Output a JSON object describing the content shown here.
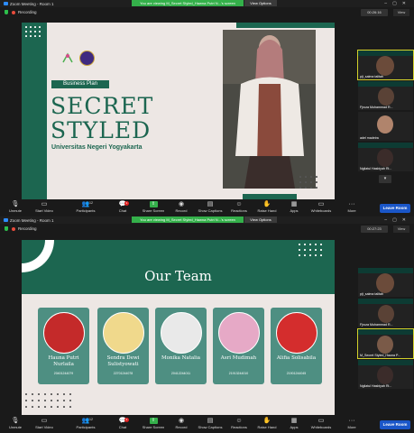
{
  "app": {
    "window_title": "Zoom Meeting - Room 1",
    "recording_label": "Recording",
    "view_options": "View Options",
    "leave_label": "Leave Room",
    "accent": "#2d8cff",
    "share_color": "#34b04a"
  },
  "top": {
    "banner": "You are viewing M_Secret Styled_Hawna Putri N...'s screen",
    "timer": "00:26:16",
    "grid_label": "View",
    "slide": {
      "subtitle": "Business Plan",
      "title_line1": "SECRET",
      "title_line2": "STYLED",
      "university": "Universitas Negeri Yogyakarta"
    },
    "participants": [
      {
        "name": "pjt_salma talitah",
        "highlight": true
      },
      {
        "name": "Fjroza Muhammad R...",
        "highlight": false
      },
      {
        "name": "adel madeira",
        "highlight": false
      },
      {
        "name": "Ngilatul Hasbiyah Ri...",
        "highlight": false
      }
    ]
  },
  "bottom": {
    "banner": "You are viewing M_Secret Styled_Hawna Putri N...'s screen",
    "timer": "00:27:23",
    "grid_label": "View",
    "slide": {
      "title": "Our Team",
      "members": [
        {
          "name": "Hauna Putri Nurlaila",
          "id": "20401244079"
        },
        {
          "name": "Sendra Dewi Sulistyowati",
          "id": "22701244078"
        },
        {
          "name": "Monika Natalia",
          "id": "20412244011"
        },
        {
          "name": "Asri Mudimah",
          "id": "21913244010"
        },
        {
          "name": "Alifia Solisabila",
          "id": "21901244045"
        }
      ]
    },
    "participants": [
      {
        "name": "pjt_salma talitah",
        "highlight": false
      },
      {
        "name": "Fjroza Muhammad R...",
        "highlight": false
      },
      {
        "name": "M_Secret Styled_Hauna P...",
        "highlight": true
      },
      {
        "name": "Ngilatul Hasbiyah Ri...",
        "highlight": false
      }
    ]
  },
  "toolbar": {
    "unmute": "Unmute",
    "start_video": "Start Video",
    "participants": "Participants",
    "participants_count": "12",
    "chat": "Chat",
    "chat_badge": "1",
    "share_screen": "Share Screen",
    "record": "Record",
    "show_captions": "Show Captions",
    "reactions": "Reactions",
    "raise_hand": "Raise Hand",
    "apps": "Apps",
    "whiteboards": "Whiteboards",
    "more": "More"
  }
}
